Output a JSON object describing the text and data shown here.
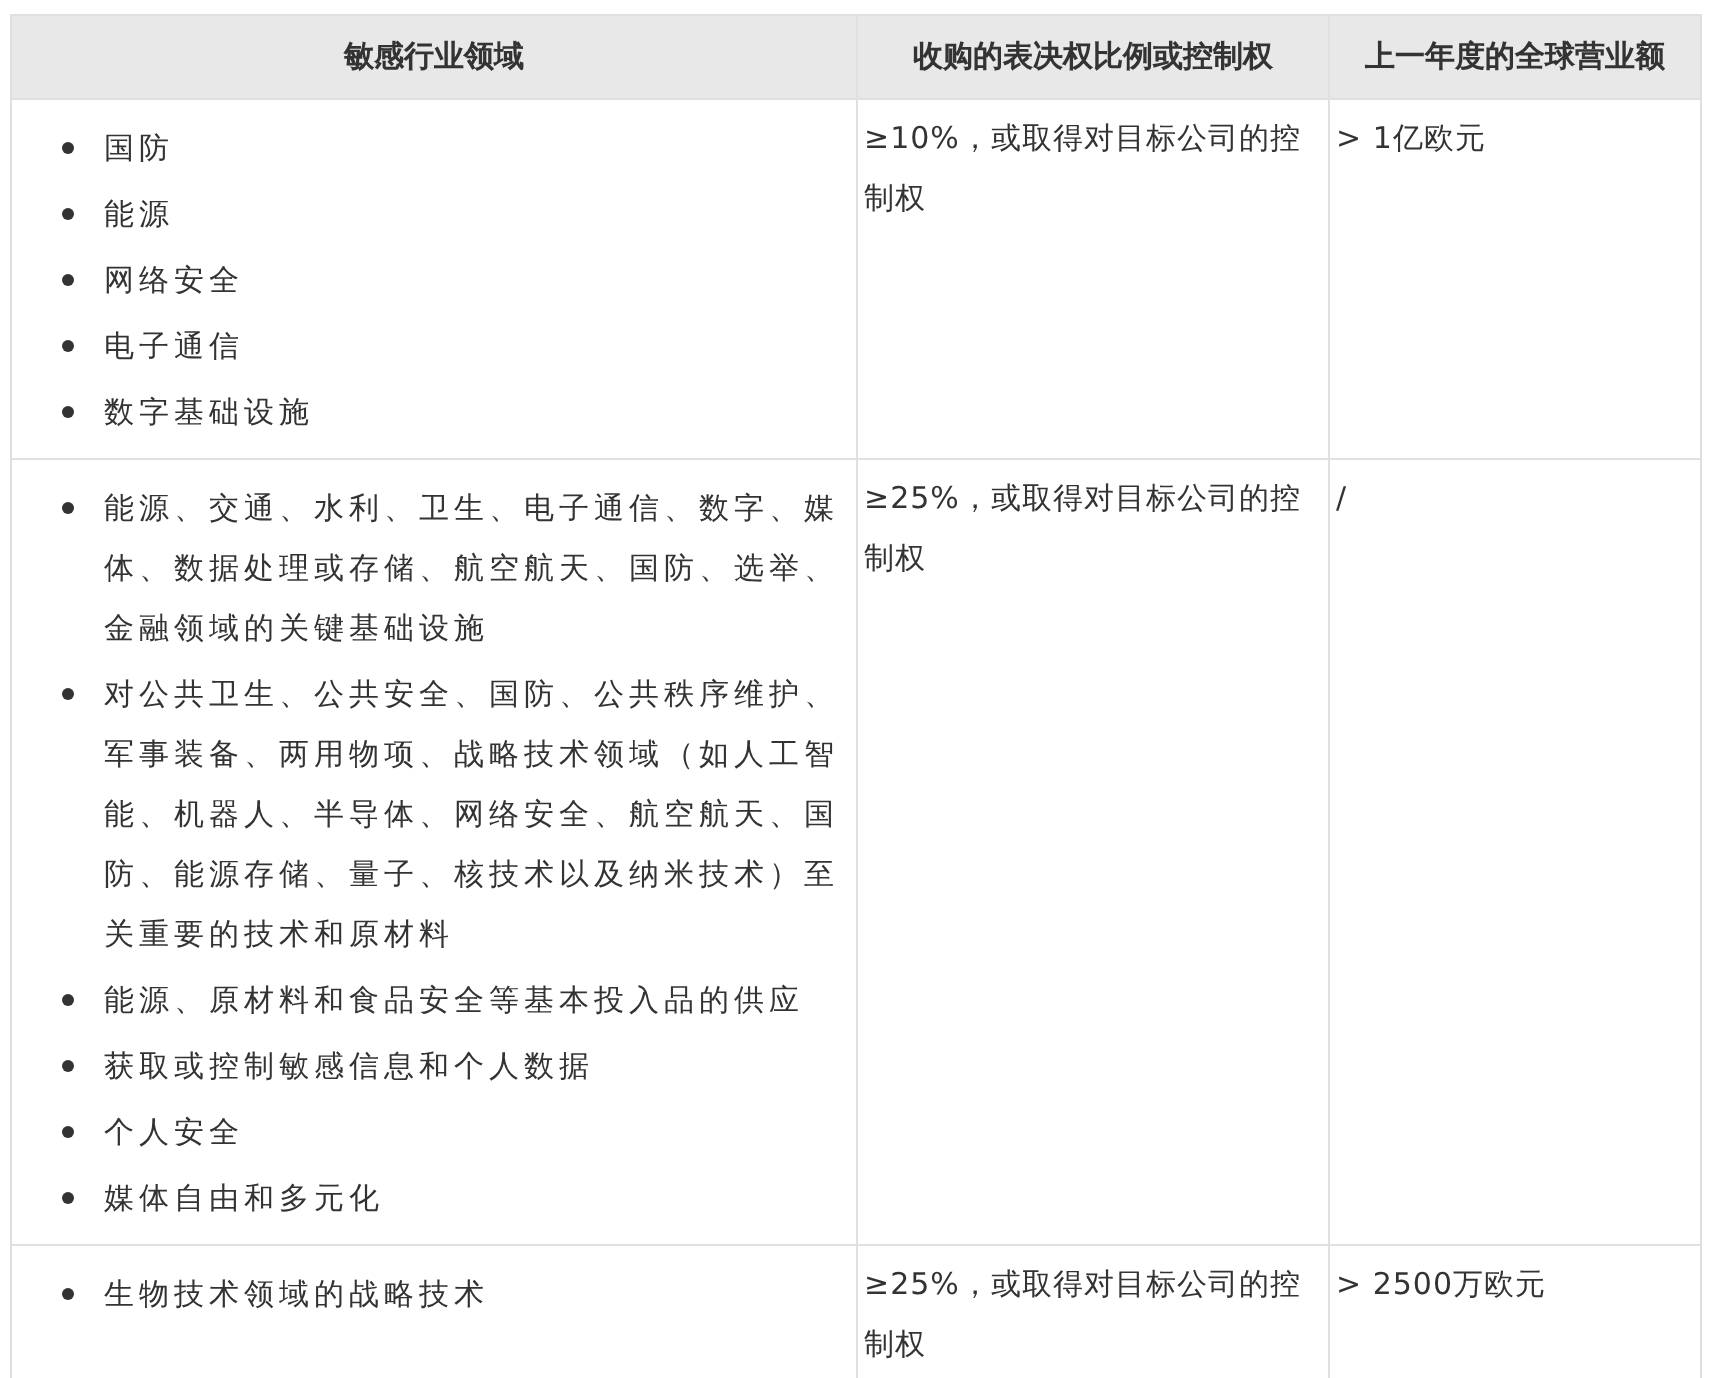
{
  "table": {
    "columns": [
      "敏感行业领域",
      "收购的表决权比例或控制权",
      "上一年度的全球营业额"
    ],
    "rows": [
      {
        "sectors": [
          "国防",
          "能源",
          "网络安全",
          "电子通信",
          "数字基础设施"
        ],
        "threshold": "≥10%，或取得对目标公司的控制权",
        "turnover": "> 1亿欧元"
      },
      {
        "sectors": [
          "能源、交通、水利、卫生、电子通信、数字、媒体、数据处理或存储、航空航天、国防、选举、金融领域的关键基础设施",
          "对公共卫生、公共安全、国防、公共秩序维护、军事装备、两用物项、战略技术领域（如人工智能、机器人、半导体、网络安全、航空航天、国防、能源存储、量子、核技术以及纳米技术）至关重要的技术和原材料",
          "能源、原材料和食品安全等基本投入品的供应",
          "获取或控制敏感信息和个人数据",
          "个人安全",
          "媒体自由和多元化"
        ],
        "threshold": "≥25%，或取得对目标公司的控制权",
        "turnover": "/"
      },
      {
        "sectors": [
          "生物技术领域的战略技术"
        ],
        "threshold": "≥25%，或取得对目标公司的控制权",
        "turnover": "> 2500万欧元"
      }
    ]
  }
}
